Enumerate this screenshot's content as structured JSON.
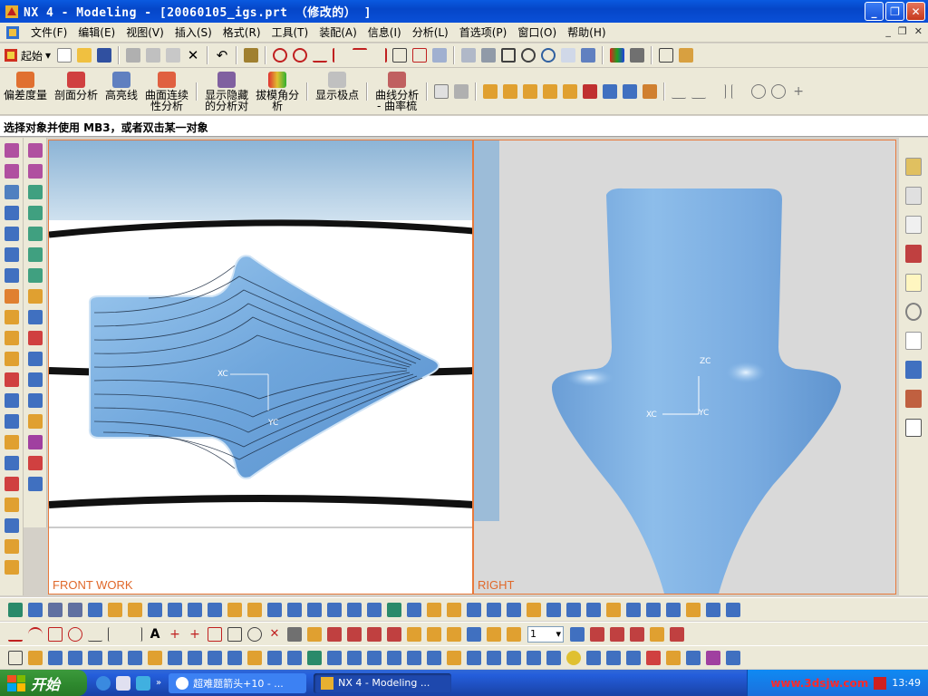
{
  "window": {
    "title": "NX 4 - Modeling - [20060105_igs.prt （修改的） ]",
    "controls": {
      "minimize": "_",
      "restore": "❐",
      "close": "✕"
    }
  },
  "menubar": {
    "items": [
      "文件(F)",
      "编辑(E)",
      "视图(V)",
      "插入(S)",
      "格式(R)",
      "工具(T)",
      "装配(A)",
      "信息(I)",
      "分析(L)",
      "首选项(P)",
      "窗口(O)",
      "帮助(H)"
    ],
    "mdi_controls": [
      "_",
      "❐",
      "✕"
    ]
  },
  "toolbar1": {
    "start_label": "起始"
  },
  "toolbar2": {
    "buttons": [
      "偏差度量",
      "剖面分析",
      "高亮线",
      "曲面连续\n性分析",
      "显示隐藏\n的分析对",
      "拔模角分\n析",
      "显示极点",
      "曲线分析\n- 曲率梳"
    ]
  },
  "status_prompt": "选择对象并使用 MB3，或者双击某一对象",
  "viewports": {
    "left": {
      "label": "FRONT WORK",
      "axis_x": "XC",
      "axis_y": "YC"
    },
    "right": {
      "label": "RIGHT",
      "axis_x": "XC",
      "axis_z": "ZC",
      "axis_y": "YC"
    }
  },
  "layer_select": {
    "value": "1"
  },
  "taskbar": {
    "start_label": "开始",
    "tasks": [
      "超难题箭头+10 - ...",
      "NX 4 - Modeling ..."
    ],
    "clock": "13:49",
    "watermark": "www.3dsjw.com"
  }
}
